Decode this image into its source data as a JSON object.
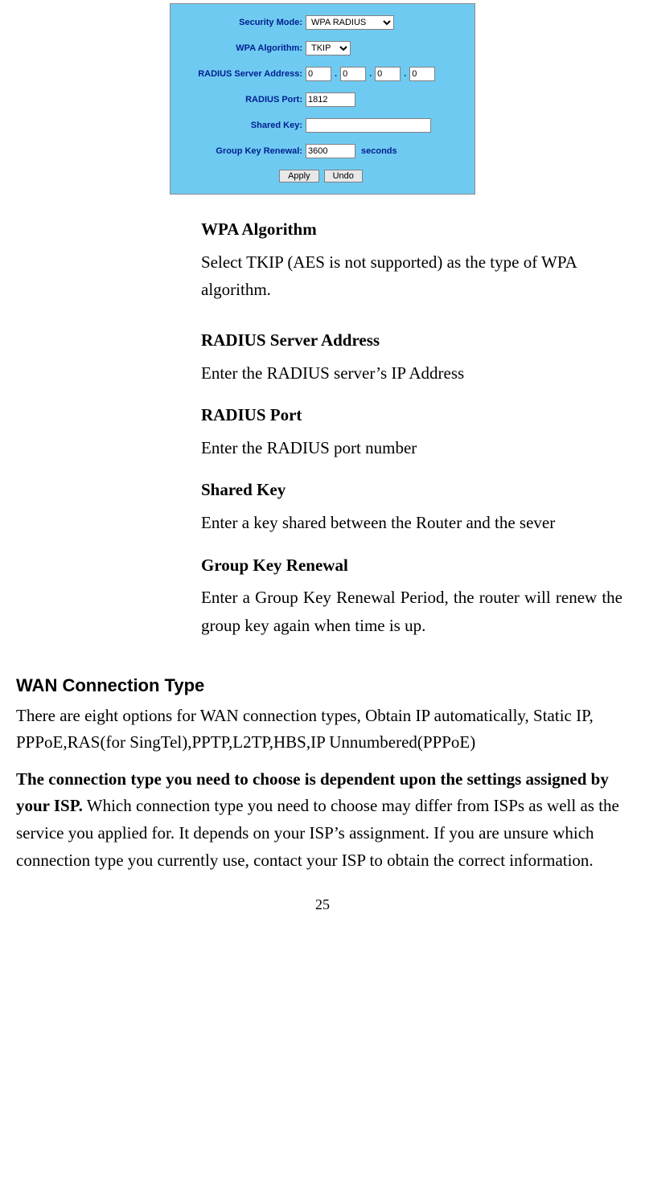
{
  "router_panel": {
    "rows": {
      "security_mode": {
        "label": "Security Mode:",
        "value": "WPA RADIUS"
      },
      "wpa_algorithm": {
        "label": "WPA Algorithm:",
        "value": "TKIP"
      },
      "radius_addr": {
        "label": "RADIUS Server Address:",
        "o1": "0",
        "o2": "0",
        "o3": "0",
        "o4": "0"
      },
      "radius_port": {
        "label": "RADIUS Port:",
        "value": "1812"
      },
      "shared_key": {
        "label": "Shared Key:",
        "value": ""
      },
      "group_renewal": {
        "label": "Group Key Renewal:",
        "value": "3600",
        "unit": "seconds"
      }
    },
    "buttons": {
      "apply": "Apply",
      "undo": "Undo"
    }
  },
  "terms": {
    "wpa_algo": {
      "title": "WPA Algorithm",
      "desc": "Select TKIP (AES is not supported) as the type of WPA algorithm."
    },
    "radius_addr": {
      "title": "RADIUS Server Address",
      "desc": "Enter the RADIUS server’s IP Address"
    },
    "radius_port": {
      "title": "RADIUS Port",
      "desc": "Enter the RADIUS port number"
    },
    "shared_key": {
      "title": "Shared Key",
      "desc": "Enter a key shared between the Router and the sever"
    },
    "group_key": {
      "title": "Group Key Renewal",
      "desc": "Enter a Group Key Renewal Period, the router will renew the group key again when time is up."
    }
  },
  "section": {
    "heading": "WAN Connection Type",
    "para1": "There are eight options for WAN connection types, Obtain IP automatically, Static IP, PPPoE,RAS(for SingTel),PPTP,L2TP,HBS,IP Unnumbered(PPPoE)",
    "para2_bold": "The connection type you need to choose is dependent upon the settings assigned by your ISP.",
    "para2_rest": " Which connection type you need to choose may differ from ISPs as well as the service you applied for. It depends on your ISP’s assignment. If you are unsure which connection type you currently use, contact your ISP to obtain the correct information."
  },
  "page_number": "25"
}
